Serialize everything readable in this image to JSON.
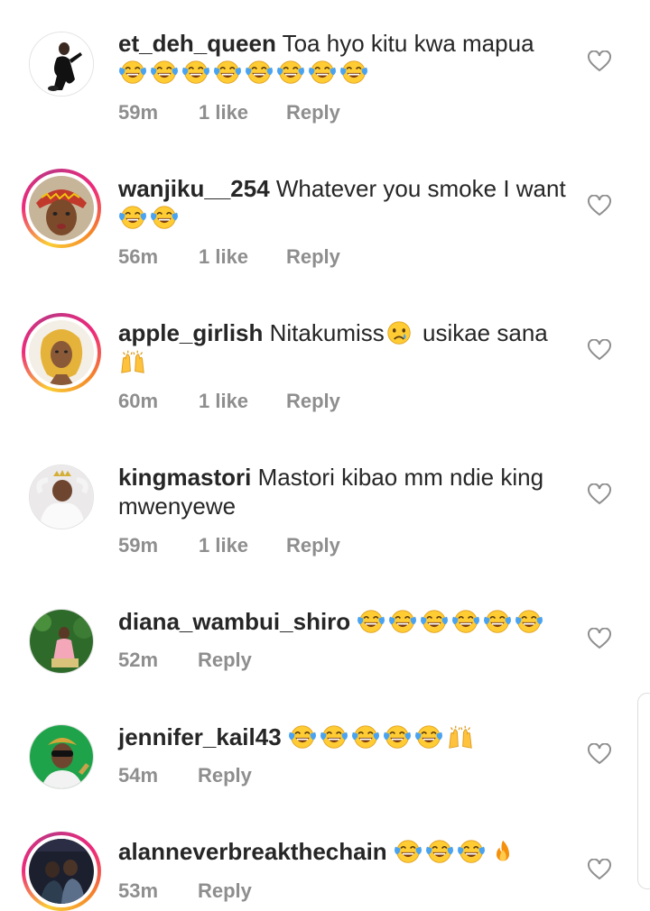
{
  "comments": [
    {
      "username": "et_deh_queen",
      "text": "Toa hyo kitu kwa mapua",
      "emojis": [
        "laugh",
        "laugh",
        "laugh",
        "laugh",
        "laugh",
        "laugh",
        "laugh",
        "laugh"
      ],
      "time": "59m",
      "likes": "1 like",
      "reply": "Reply",
      "avatar": "avatar-woman-black-outfit",
      "story_ring": false
    },
    {
      "username": "wanjiku__254",
      "text": "Whatever you smoke I want",
      "emojis": [
        "laugh",
        "laugh"
      ],
      "time": "56m",
      "likes": "1 like",
      "reply": "Reply",
      "avatar": "avatar-woman-headwrap",
      "story_ring": true
    },
    {
      "username": "apple_girlish",
      "text": "Nitakumiss",
      "emojis_inline": [
        "cry"
      ],
      "text2": " usikae sana",
      "emojis": [
        "raised-hands"
      ],
      "time": "60m",
      "likes": "1 like",
      "reply": "Reply",
      "avatar": "avatar-woman-blonde",
      "story_ring": true
    },
    {
      "username": "kingmastori",
      "text": "Mastori kibao mm ndie king mwenyewe",
      "emojis": [],
      "time": "59m",
      "likes": "1 like",
      "reply": "Reply",
      "avatar": "avatar-crown-white",
      "story_ring": false
    },
    {
      "username": "diana_wambui_shiro",
      "text": "",
      "emojis": [
        "laugh",
        "laugh",
        "laugh",
        "laugh",
        "laugh",
        "laugh"
      ],
      "time": "52m",
      "likes": "",
      "reply": "Reply",
      "avatar": "avatar-woman-pink-garden",
      "story_ring": false
    },
    {
      "username": "jennifer_kail43",
      "text": "",
      "emojis": [
        "laugh",
        "laugh",
        "laugh",
        "laugh",
        "laugh",
        "raised-hands"
      ],
      "time": "54m",
      "likes": "",
      "reply": "Reply",
      "avatar": "avatar-woman-sunglasses-green",
      "story_ring": false
    },
    {
      "username": "alanneverbreakthechain",
      "text": "",
      "emojis": [
        "laugh",
        "laugh",
        "laugh",
        "fire"
      ],
      "time": "53m",
      "likes": "",
      "reply": "Reply",
      "avatar": "avatar-dark-group",
      "story_ring": true
    }
  ],
  "icons": {
    "like": "heart-outline-icon",
    "laugh": "face-with-tears-of-joy-emoji",
    "cry": "crying-face-emoji",
    "raised": "raised-hands-emoji",
    "fire": "fire-emoji"
  },
  "colors": {
    "text": "#262626",
    "meta": "#8e8e8e",
    "story_ring_start": "#f9ce34",
    "story_ring_end": "#ee2a7b"
  }
}
